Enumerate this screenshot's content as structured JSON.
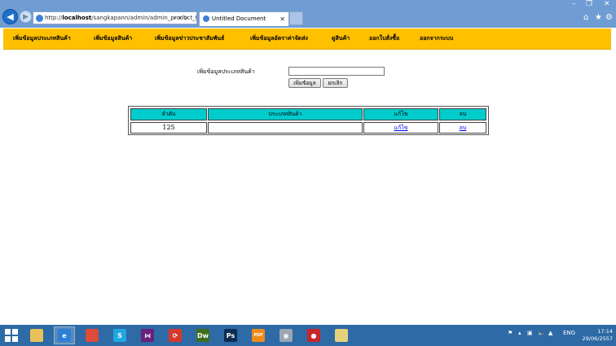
{
  "browser": {
    "url_prefix": "http://",
    "url_host": "localhost",
    "url_path": "/sangkapann/admin/admin_product_t",
    "url_tools": "⌕ ▾ ↻",
    "tab_title": "Untitled Document",
    "tab_close": "✕",
    "window_controls": {
      "minimize": "–",
      "restore": "❐",
      "close": "✕"
    },
    "toolbar_icons": {
      "home": "⌂",
      "favorites": "★",
      "settings": "⚙"
    }
  },
  "menu": {
    "items": [
      "เพิ่มข้อมูลประเภทสินค้า",
      "เพิ่มข้อมูลสินค้า",
      "เพิ่มข้อมูลข่าวประชาสัมพันธ์",
      "เพิ่มข้อมูลอัตราค่าจัดส่ง",
      "ดูสินค้า",
      "ออกใบสั่งซื้อ",
      "ออกจากระบบ"
    ]
  },
  "form": {
    "label": "เพิ่มข้อมูลประเภทสินค้า",
    "input_value": "",
    "add_button": "เพิ่มข้อมูล",
    "cancel_button": "ยกเลิก"
  },
  "table": {
    "headers": [
      "ลำดับ",
      "ประเภทสินค้า",
      "แก้ไข",
      "ลบ"
    ],
    "rows": [
      {
        "id": "125",
        "category": "",
        "edit": "แก้ไข",
        "delete": "ลบ"
      }
    ]
  },
  "taskbar": {
    "apps": [
      {
        "name": "file-explorer",
        "label": "",
        "color": "#e8c15a"
      },
      {
        "name": "internet-explorer",
        "label": "e",
        "color": "#2b7fd8",
        "active": true
      },
      {
        "name": "chrome",
        "label": "",
        "color": "#dd4b39"
      },
      {
        "name": "skype",
        "label": "S",
        "color": "#1fa7e1"
      },
      {
        "name": "visual-studio",
        "label": "⋈",
        "color": "#68217a"
      },
      {
        "name": "app-red",
        "label": "⟳",
        "color": "#d9372b"
      },
      {
        "name": "dreamweaver",
        "label": "Dw",
        "color": "#3f6e1e"
      },
      {
        "name": "photoshop",
        "label": "Ps",
        "color": "#0b2d52"
      },
      {
        "name": "pdf-app",
        "label": "PDF",
        "color": "#f08a1a"
      },
      {
        "name": "app-white",
        "label": "◉",
        "color": "#9aa7b3"
      },
      {
        "name": "app-round-red",
        "label": "●",
        "color": "#c8262b"
      },
      {
        "name": "app-folder",
        "label": "",
        "color": "#e6d27a"
      }
    ],
    "tray_language": "ENG",
    "time": "17:14",
    "date": "29/06/2557"
  }
}
